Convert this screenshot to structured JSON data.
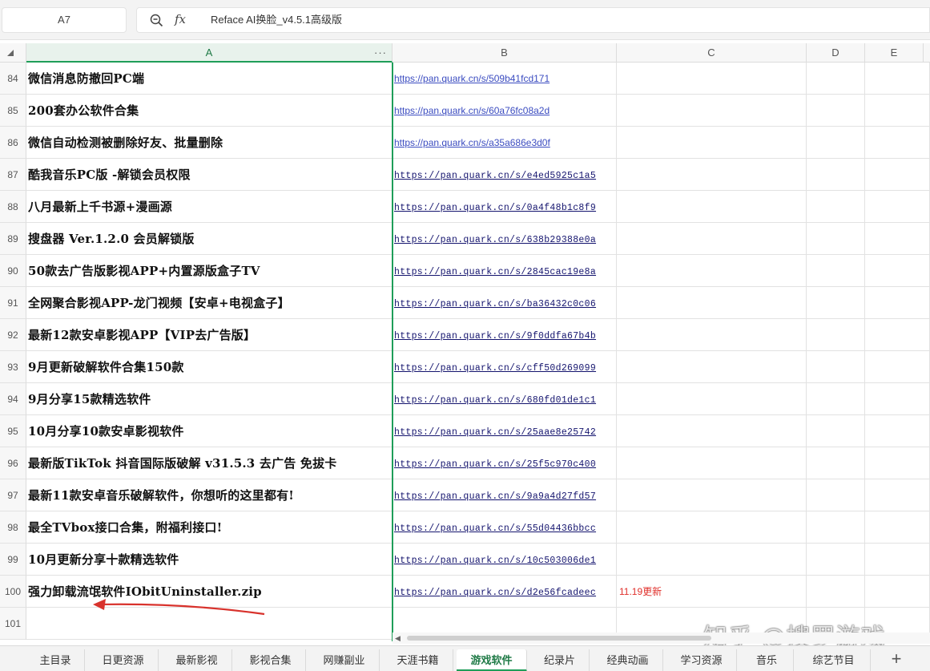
{
  "namebox": "A7",
  "formula": "Reface AI换脸_v4.5.1高级版",
  "columns": [
    "A",
    "B",
    "C",
    "D",
    "E"
  ],
  "rows": [
    {
      "num": "84",
      "name": "微信消息防撤回PC端",
      "link": "https://pan.quark.cn/s/509b41fcd171",
      "mono": false,
      "note": ""
    },
    {
      "num": "85",
      "name": "200套办公软件合集",
      "link": "https://pan.quark.cn/s/60a76fc08a2d",
      "mono": false,
      "note": ""
    },
    {
      "num": "86",
      "name": "微信自动检测被删除好友、批量删除",
      "link": "https://pan.quark.cn/s/a35a686e3d0f",
      "mono": false,
      "note": ""
    },
    {
      "num": "87",
      "name": "酷我音乐PC版 -解锁会员权限",
      "link": "https://pan.quark.cn/s/e4ed5925c1a5",
      "mono": true,
      "note": ""
    },
    {
      "num": "88",
      "name": "八月最新上千书源+漫画源",
      "link": "https://pan.quark.cn/s/0a4f48b1c8f9",
      "mono": true,
      "note": ""
    },
    {
      "num": "89",
      "name": "搜盘器 Ver.1.2.0 会员解锁版",
      "link": "https://pan.quark.cn/s/638b29388e0a",
      "mono": true,
      "note": ""
    },
    {
      "num": "90",
      "name": "50款去广告版影视APP+内置源版盒子TV",
      "link": "https://pan.quark.cn/s/2845cac19e8a",
      "mono": true,
      "note": ""
    },
    {
      "num": "91",
      "name": "全网聚合影视APP-龙门视频【安卓+电视盒子】",
      "link": "https://pan.quark.cn/s/ba36432c0c06",
      "mono": true,
      "note": ""
    },
    {
      "num": "92",
      "name": "最新12款安卓影视APP【VIP去广告版】",
      "link": "https://pan.quark.cn/s/9f0ddfa67b4b",
      "mono": true,
      "note": ""
    },
    {
      "num": "93",
      "name": "9月更新破解软件合集150款",
      "link": "https://pan.quark.cn/s/cff50d269099",
      "mono": true,
      "note": ""
    },
    {
      "num": "94",
      "name": "9月分享15款精选软件",
      "link": "https://pan.quark.cn/s/680fd01de1c1",
      "mono": true,
      "note": ""
    },
    {
      "num": "95",
      "name": "10月分享10款安卓影视软件",
      "link": "https://pan.quark.cn/s/25aae8e25742",
      "mono": true,
      "note": ""
    },
    {
      "num": "96",
      "name": "最新版TikTok 抖音国际版破解 v31.5.3 去广告 免拔卡",
      "link": "https://pan.quark.cn/s/25f5c970c400",
      "mono": true,
      "note": ""
    },
    {
      "num": "97",
      "name": "最新11款安卓音乐破解软件，你想听的这里都有!",
      "link": "https://pan.quark.cn/s/9a9a4d27fd57",
      "mono": true,
      "note": ""
    },
    {
      "num": "98",
      "name": "最全TVbox接口合集，附福利接口!",
      "link": "https://pan.quark.cn/s/55d04436bbcc",
      "mono": true,
      "note": ""
    },
    {
      "num": "99",
      "name": "10月更新分享十款精选软件",
      "link": "https://pan.quark.cn/s/10c503006de1",
      "mono": true,
      "note": ""
    },
    {
      "num": "100",
      "name": "强力卸载流氓软件IObitUninstaller.zip",
      "link": "https://pan.quark.cn/s/d2e56fcadeec",
      "mono": true,
      "note": "11.19更新"
    },
    {
      "num": "101",
      "name": "",
      "link": "",
      "mono": false,
      "note": ""
    }
  ],
  "tabs": [
    "主目录",
    "日更资源",
    "最新影视",
    "影视合集",
    "网赚副业",
    "天涯书籍",
    "游戏软件",
    "纪录片",
    "经典动画",
    "学习资源",
    "音乐",
    "综艺节目"
  ],
  "active_tab": "游戏软件",
  "watermark": "知乎 @搜罗游戏",
  "icons": {
    "zoom": "zoom-icon",
    "fx": "fx-icon",
    "add_sheet": "plus-icon"
  },
  "colors": {
    "accent": "#1f9e59",
    "link": "#3b4cc0",
    "note": "#e0302b"
  }
}
